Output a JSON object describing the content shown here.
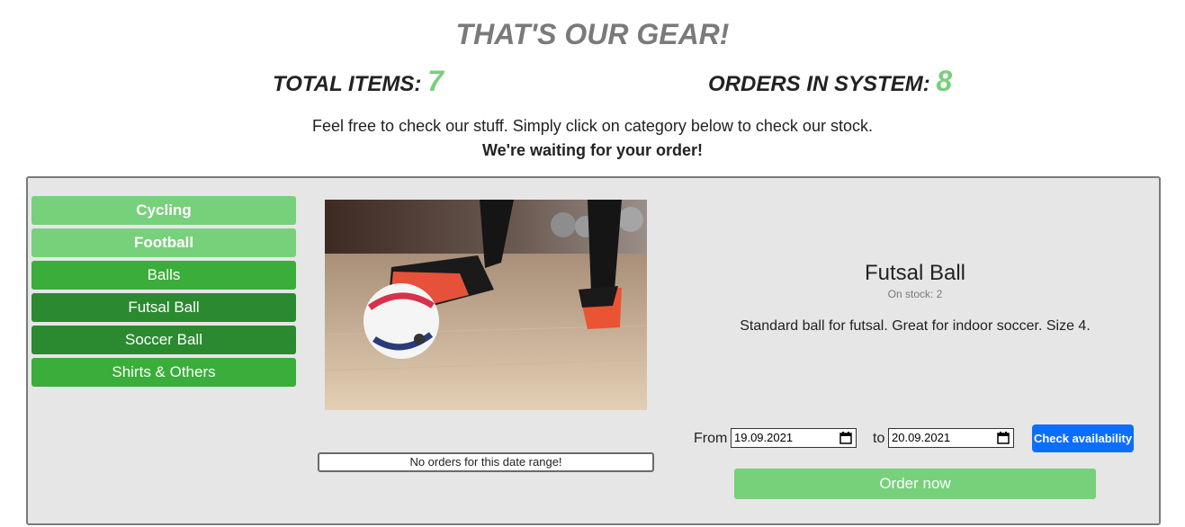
{
  "header": {
    "title": "THAT'S OUR GEAR!",
    "total_items_label": "TOTAL ITEMS:",
    "total_items_value": "7",
    "orders_label": "ORDERS IN SYSTEM:",
    "orders_value": "8",
    "intro": "Feel free to check our stuff. Simply click on category below to check our stock.",
    "intro_strong": "We're waiting for your order!"
  },
  "categories": [
    {
      "label": "Cycling"
    },
    {
      "label": "Football"
    },
    {
      "label": "Balls"
    },
    {
      "label": "Futsal Ball"
    },
    {
      "label": "Soccer Ball"
    },
    {
      "label": "Shirts & Others"
    }
  ],
  "product": {
    "name": "Futsal Ball",
    "stock": "On stock: 2",
    "description": "Standard ball for futsal. Great for indoor soccer. Size 4.",
    "image_icon": "futsal-photo"
  },
  "orders_notice": "No orders for this date range!",
  "availability": {
    "from_label": "From",
    "from_value": "19.09.2021",
    "to_label": "to",
    "to_value": "20.09.2021",
    "calendar_icon": "calendar-icon",
    "check_label": "Check availability"
  },
  "order_label": "Order now",
  "colors": {
    "accent_green": "#77d07a",
    "mid_green": "#3aad3a",
    "dark_green": "#2b8a30",
    "primary_blue": "#0d6efd"
  }
}
